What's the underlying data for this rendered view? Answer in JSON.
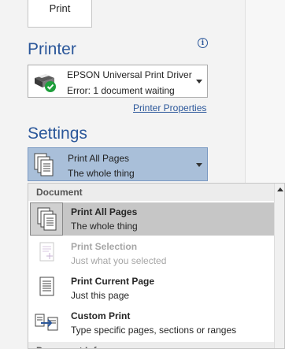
{
  "print_button": {
    "label": "Print"
  },
  "printer": {
    "section_title": "Printer",
    "name": "EPSON Universal Print Driver",
    "status": "Error: 1 document waiting",
    "properties_link": "Printer Properties"
  },
  "settings": {
    "section_title": "Settings",
    "selected_title": "Print All Pages",
    "selected_subtitle": "The whole thing"
  },
  "dropdown": {
    "group_header": "Document",
    "items": [
      {
        "title": "Print All Pages",
        "subtitle": "The whole thing",
        "icon": "multi-page-icon",
        "state": "selected"
      },
      {
        "title": "Print Selection",
        "subtitle": "Just what you selected",
        "icon": "selection-icon",
        "state": "disabled"
      },
      {
        "title": "Print Current Page",
        "subtitle": "Just this page",
        "icon": "single-page-icon",
        "state": "normal"
      },
      {
        "title": "Custom Print",
        "subtitle": "Type specific pages, sections or ranges",
        "icon": "custom-print-icon",
        "state": "normal"
      }
    ],
    "next_group_header": "Document Info"
  },
  "colors": {
    "accent": "#2b579a",
    "selected_box": "#a9bfd9",
    "selected_item": "#c6c6c6",
    "status_ok": "#1e9e3b"
  }
}
